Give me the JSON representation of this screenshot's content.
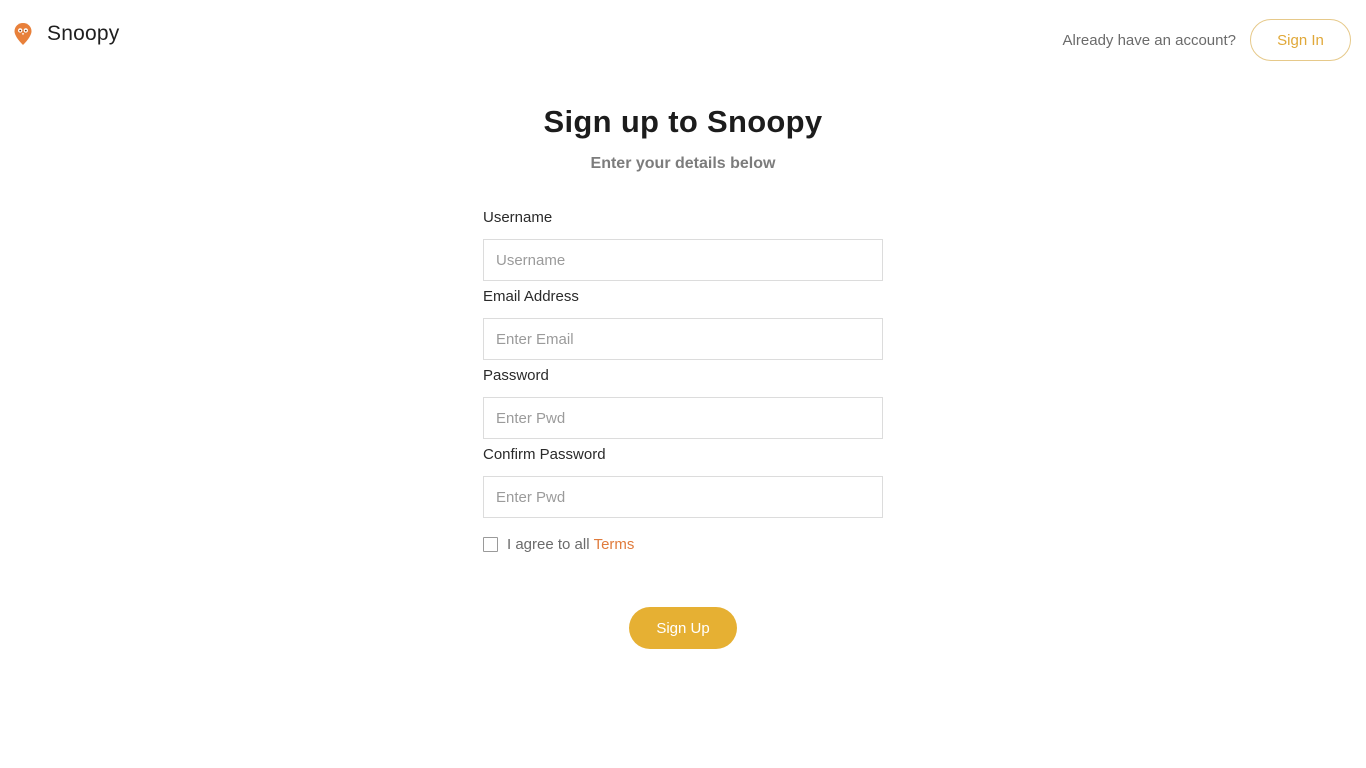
{
  "header": {
    "brand_name": "Snoopy",
    "brand_icon": "owl-map-pin-icon",
    "question": "Already have an account?",
    "signin_label": "Sign In"
  },
  "main": {
    "title": "Sign up to Snoopy",
    "subtitle": "Enter your details below",
    "fields": [
      {
        "label": "Username",
        "placeholder": "Username",
        "value": ""
      },
      {
        "label": "Email Address",
        "placeholder": "Enter Email",
        "value": ""
      },
      {
        "label": "Password",
        "placeholder": "Enter Pwd",
        "value": ""
      },
      {
        "label": "Confirm Password",
        "placeholder": "Enter Pwd",
        "value": ""
      }
    ],
    "agree_text": "I agree to all",
    "terms_label": "Terms",
    "agree_checked": false,
    "signup_label": "Sign Up"
  },
  "colors": {
    "accent": "#e6b033",
    "accent_text": "#e0a838",
    "link": "#e07b3c",
    "brand_icon": "#e8803a"
  }
}
